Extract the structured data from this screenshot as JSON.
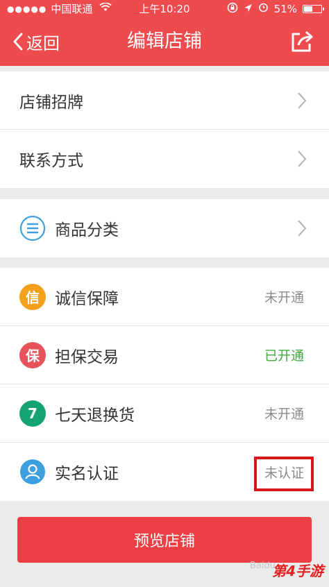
{
  "status_bar": {
    "signal_dots": "●●●●●",
    "carrier": "中国联通",
    "time": "上午10:20",
    "battery": "51%",
    "battery_level": 0.51
  },
  "nav": {
    "back_label": "返回",
    "title": "编辑店铺",
    "share_icon": "share-icon"
  },
  "group1": [
    {
      "label": "店铺招牌"
    },
    {
      "label": "联系方式"
    }
  ],
  "group2": [
    {
      "label": "商品分类",
      "icon": "list-icon",
      "color": "#3b9fe0"
    }
  ],
  "group3": [
    {
      "label": "诚信保障",
      "icon_text": "信",
      "color": "#f3a01b",
      "status": "未开通"
    },
    {
      "label": "担保交易",
      "icon_text": "保",
      "color": "#e8525a",
      "status": "已开通"
    },
    {
      "label": "七天退换货",
      "icon_text": "7",
      "color": "#14a473",
      "status": "未开通"
    },
    {
      "label": "实名认证",
      "icon": "person-icon",
      "color": "#3b9fe0",
      "status": "未认证"
    }
  ],
  "colors": {
    "brand": "#ee4b4f",
    "status_on": "#3eab3c",
    "status_off": "#8a8a8a",
    "highlight_box": "#d8141c"
  },
  "preview_button": "预览店铺",
  "watermarks": {
    "baidu": "Baidu",
    "site": "第4手游"
  }
}
